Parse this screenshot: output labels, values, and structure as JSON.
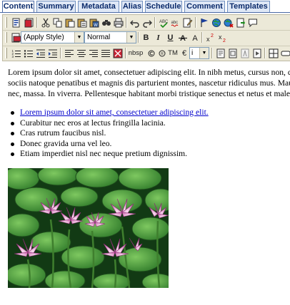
{
  "tabs": [
    {
      "label": "Content",
      "active": true
    },
    {
      "label": "Summary",
      "active": false
    },
    {
      "label": "Metadata",
      "active": false
    },
    {
      "label": "Alias",
      "active": false
    },
    {
      "label": "Schedule",
      "active": false
    },
    {
      "label": "Comment",
      "active": false
    },
    {
      "label": "Templates",
      "active": false
    }
  ],
  "toolbar": {
    "style_select": "(Apply Style)",
    "format_select": "Normal",
    "bold": "B",
    "italic": "I",
    "underline": "U",
    "nbsp": "nbsp",
    "trademark": "TM",
    "euro": "€"
  },
  "content": {
    "paragraph_lines": [
      "Lorem ipsum dolor sit amet, consectetuer adipiscing elit. In nibh metus, cursus non, cong",
      "sociis natoque penatibus et magnis dis parturient montes, nascetur ridiculus mus. Mauris",
      "nec, massa. In viverra. Pellentesque habitant morbi tristique senectus et netus et malesua"
    ],
    "list_items": [
      "Lorem ipsum dolor sit amet, consectetuer adipiscing elit.",
      "Curabitur nec eros at lectus fringilla lacinia.",
      "Cras rutrum faucibus nisl.",
      "Donec gravida urna vel leo.",
      "Etiam imperdiet nisl nec neque pretium dignissim."
    ]
  },
  "colors": {
    "tab_bg": "#dfe8f6",
    "tab_border": "#4a6aa5",
    "toolbar_bg": "#ece9d8",
    "link": "#0000cc"
  }
}
